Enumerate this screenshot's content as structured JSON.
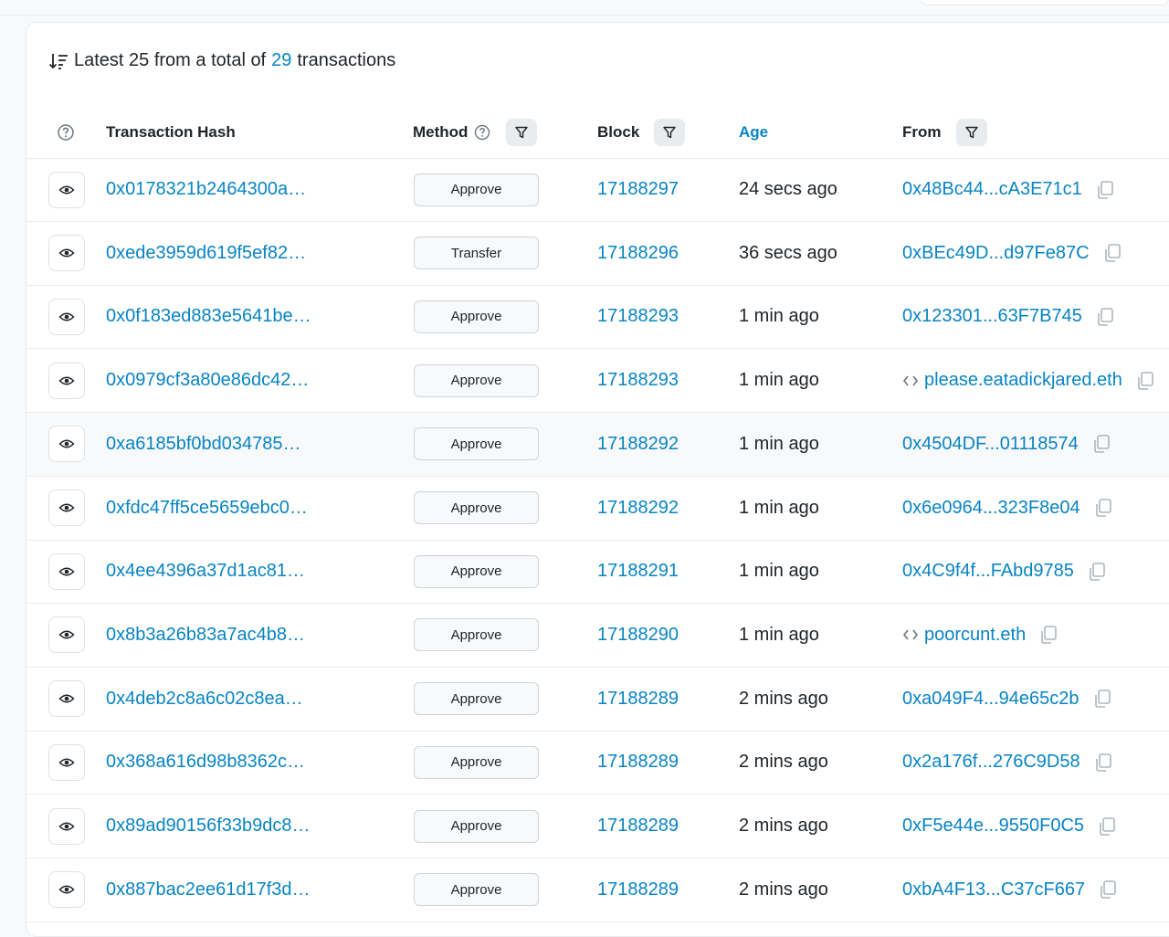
{
  "summary": {
    "prefix": "Latest 25 from a total of",
    "total": "29",
    "suffix": "transactions"
  },
  "columns": {
    "hash": "Transaction Hash",
    "method": "Method",
    "block": "Block",
    "age": "Age",
    "from": "From"
  },
  "icons": {
    "sort": "sort-descending-icon",
    "help": "question-circle-icon",
    "filter": "filter-icon",
    "eye": "eye-icon",
    "copy": "copy-icon",
    "contract": "code-contract-icon"
  },
  "colors": {
    "link": "#0784c3",
    "text": "#212529",
    "border": "#e9ecef"
  },
  "rows": [
    {
      "hash": "0x0178321b2464300a…",
      "method": "Approve",
      "block": "17188297",
      "age": "24 secs ago",
      "from": "0x48Bc44...cA3E71c1",
      "contract": false
    },
    {
      "hash": "0xede3959d619f5ef82…",
      "method": "Transfer",
      "block": "17188296",
      "age": "36 secs ago",
      "from": "0xBEc49D...d97Fe87C",
      "contract": false
    },
    {
      "hash": "0x0f183ed883e5641be…",
      "method": "Approve",
      "block": "17188293",
      "age": "1 min ago",
      "from": "0x123301...63F7B745",
      "contract": false
    },
    {
      "hash": "0x0979cf3a80e86dc42…",
      "method": "Approve",
      "block": "17188293",
      "age": "1 min ago",
      "from": "please.eatadickjared.eth",
      "contract": true
    },
    {
      "hash": "0xa6185bf0bd034785…",
      "method": "Approve",
      "block": "17188292",
      "age": "1 min ago",
      "from": "0x4504DF...01118574",
      "contract": false
    },
    {
      "hash": "0xfdc47ff5ce5659ebc0…",
      "method": "Approve",
      "block": "17188292",
      "age": "1 min ago",
      "from": "0x6e0964...323F8e04",
      "contract": false
    },
    {
      "hash": "0x4ee4396a37d1ac81…",
      "method": "Approve",
      "block": "17188291",
      "age": "1 min ago",
      "from": "0x4C9f4f...FAbd9785",
      "contract": false
    },
    {
      "hash": "0x8b3a26b83a7ac4b8…",
      "method": "Approve",
      "block": "17188290",
      "age": "1 min ago",
      "from": "poorcunt.eth",
      "contract": true
    },
    {
      "hash": "0x4deb2c8a6c02c8ea…",
      "method": "Approve",
      "block": "17188289",
      "age": "2 mins ago",
      "from": "0xa049F4...94e65c2b",
      "contract": false
    },
    {
      "hash": "0x368a616d98b8362c…",
      "method": "Approve",
      "block": "17188289",
      "age": "2 mins ago",
      "from": "0x2a176f...276C9D58",
      "contract": false
    },
    {
      "hash": "0x89ad90156f33b9dc8…",
      "method": "Approve",
      "block": "17188289",
      "age": "2 mins ago",
      "from": "0xF5e44e...9550F0C5",
      "contract": false
    },
    {
      "hash": "0x887bac2ee61d17f3d…",
      "method": "Approve",
      "block": "17188289",
      "age": "2 mins ago",
      "from": "0xbA4F13...C37cF667",
      "contract": false
    }
  ]
}
